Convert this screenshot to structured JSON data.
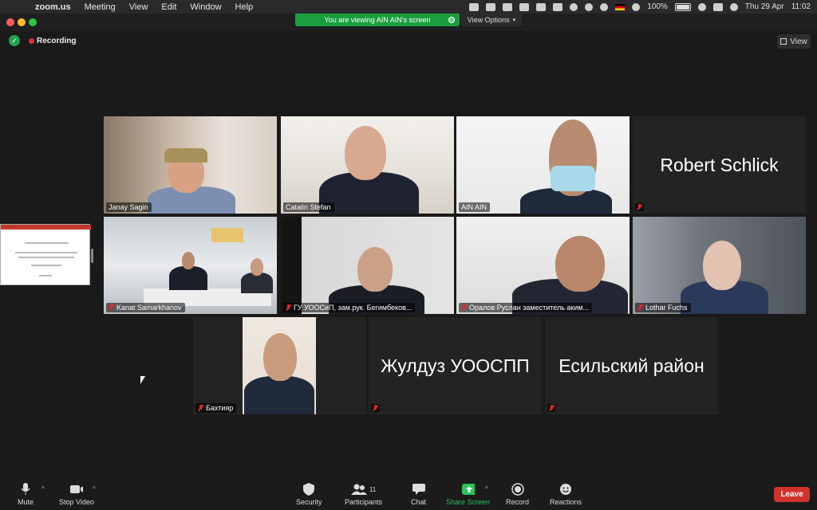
{
  "menubar": {
    "app": "zoom.us",
    "items": [
      "Meeting",
      "View",
      "Edit",
      "Window",
      "Help"
    ],
    "battery": "100%",
    "date": "Thu 29 Apr",
    "time": "11:02"
  },
  "banner": {
    "viewing": "You are viewing AIN AIN's screen",
    "view_options": "View Options"
  },
  "recording_label": "Recording",
  "view_button": "View",
  "participants": [
    {
      "name": "Janay Sagin",
      "active": true
    },
    {
      "name": "Catalin Stefan"
    },
    {
      "name": "AIN AIN"
    },
    {
      "name": "Robert Schlick",
      "video": false
    },
    {
      "name": "Kanat Samarkhanov",
      "muted": true
    },
    {
      "name": "ГУ УООСиП, зам.рук. Бегимбеков...",
      "muted": true
    },
    {
      "name": "Оралов Руслан заместитель аким...",
      "muted": true
    },
    {
      "name": "Lothar Fuchs",
      "muted": true
    },
    {
      "name": "Бахтияр",
      "muted": true
    },
    {
      "name": "Жулдуз УООСПП",
      "video": false
    },
    {
      "name": "Есильский район",
      "video": false
    }
  ],
  "toolbar": {
    "mute": "Mute",
    "stop_video": "Stop Video",
    "security": "Security",
    "participants": "Participants",
    "participants_count": "11",
    "chat": "Chat",
    "share_screen": "Share Screen",
    "record": "Record",
    "reactions": "Reactions",
    "leave": "Leave"
  },
  "colors": {
    "accent_green": "#1a9e3e",
    "leave_red": "#d0322c",
    "active_speaker": "#d7e36a"
  }
}
